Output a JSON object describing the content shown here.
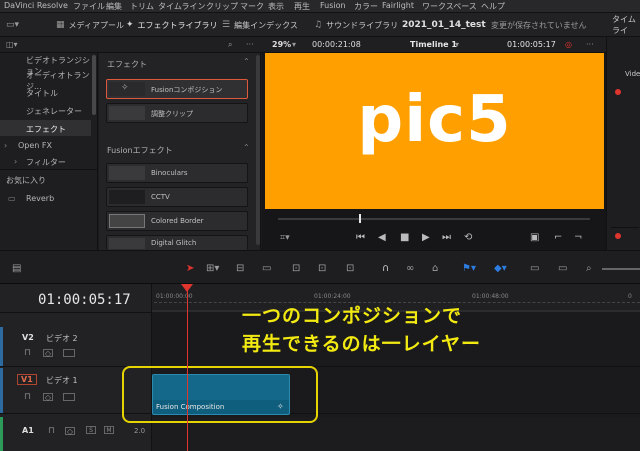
{
  "menu": {
    "items": [
      "DaVinci Resolve",
      "ファイル",
      "編集",
      "トリム",
      "タイムライン",
      "クリップ",
      "マーク",
      "表示",
      "再生",
      "Fusion",
      "カラー",
      "Fairlight",
      "ワークスペース",
      "ヘルプ"
    ]
  },
  "toolbar": {
    "media_pool": "メディアプール",
    "effects_library": "エフェクトライブラリ",
    "edit_index": "編集インデックス",
    "sound_library": "サウンドライブラリ",
    "project_name": "2021_01_14_test",
    "unsaved": "変更が保存されていません",
    "right_label": "タイムライ"
  },
  "viewer_bar": {
    "zoom": "29%",
    "source_tc": "00:00:21:08",
    "timeline_name": "Timeline 1",
    "record_tc": "01:00:05:17",
    "video_tab": "Vide"
  },
  "left_panel": {
    "items": [
      "ビデオトランジション",
      "オーディオトランジ...",
      "タイトル",
      "ジェネレーター",
      "エフェクト"
    ],
    "open_fx": "Open FX",
    "filter": "フィルター",
    "favorites": "お気に入り",
    "reverb": "Reverb"
  },
  "effects": {
    "header": "エフェクト",
    "items": [
      "Fusionコンポジション",
      "調整クリップ"
    ],
    "fusion_header": "Fusionエフェクト",
    "fusion_items": [
      "Binoculars",
      "CCTV",
      "Colored Border",
      "Digital Glitch"
    ]
  },
  "viewer": {
    "content_text": "pic5"
  },
  "timeline": {
    "timecode": "01:00:05:17",
    "ruler": [
      "01:00:00:00",
      "01:00:24:00",
      "01:00:48:00"
    ],
    "tracks": [
      {
        "id": "V2",
        "name": "ビデオ 2"
      },
      {
        "id": "V1",
        "name": "ビデオ 1"
      },
      {
        "id": "A1",
        "value": "2.0"
      }
    ],
    "clip_name": "Fusion Composition",
    "mute_label": "S",
    "m_label": "M"
  },
  "annotation": {
    "line1": "一つのコンポジションで",
    "line2": "再生できるのは一レイヤー"
  },
  "colors": {
    "viewer_bg": "#ffa000",
    "annotation": "#f3ea12",
    "clip": "#0f5e7d",
    "playhead": "#e0342f"
  }
}
